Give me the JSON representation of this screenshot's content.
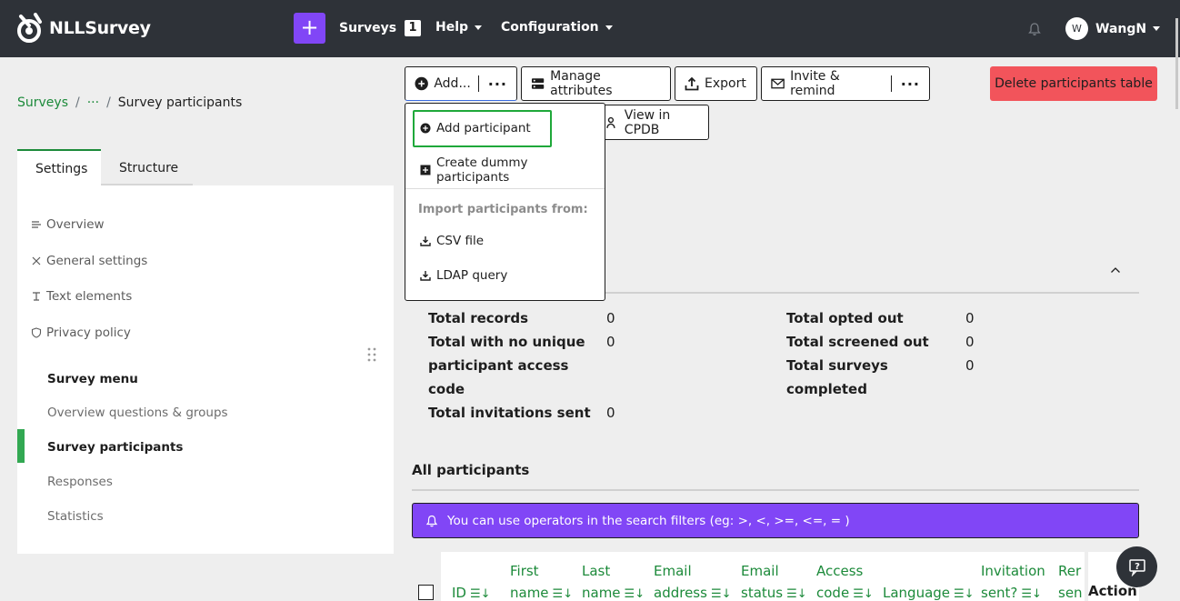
{
  "app": {
    "name": "NLLSurvey"
  },
  "nav": {
    "surveys_label": "Surveys",
    "surveys_count": "1",
    "help_label": "Help",
    "config_label": "Configuration",
    "user_initial": "W",
    "user_name": "WangN"
  },
  "breadcrumb": {
    "root": "Surveys",
    "ellipsis": "···",
    "sep": "/",
    "current": "Survey participants"
  },
  "sidebar": {
    "tabs": [
      "Settings",
      "Structure"
    ],
    "settings_items": [
      "Overview",
      "General settings",
      "Text elements",
      "Privacy policy"
    ],
    "menu_heading": "Survey menu",
    "menu_items": [
      "Overview questions & groups",
      "Survey participants",
      "Responses",
      "Statistics"
    ]
  },
  "toolbar": {
    "add_label": "Add...",
    "manage_label": "Manage attributes",
    "export_label": "Export",
    "invite_label": "Invite & remind",
    "delete_label": "Delete participants table",
    "cpdb_label": "View in CPDB"
  },
  "dropdown": {
    "add_participant": "Add participant",
    "create_dummy": "Create dummy participants",
    "import_header": "Import participants from:",
    "csv": "CSV file",
    "ldap": "LDAP query"
  },
  "summary": {
    "total_records_label": "Total records",
    "total_records": "0",
    "no_unique_label_1": "Total with no unique",
    "no_unique_label_2": "participant access",
    "no_unique_label_3": "code",
    "no_unique": "0",
    "invitations_sent_label": "Total invitations sent",
    "invitations_sent": "0",
    "opted_out_label": "Total opted out",
    "opted_out": "0",
    "screened_out_label": "Total screened out",
    "screened_out": "0",
    "completed_label_1": "Total surveys",
    "completed_label_2": "completed",
    "completed": "0"
  },
  "participants": {
    "title": "All participants",
    "info": "You can use operators in the search filters (eg: >, <, >=, <=, = )",
    "columns": [
      [
        "",
        "ID"
      ],
      [
        "First",
        "name"
      ],
      [
        "Last",
        "name"
      ],
      [
        "Email",
        "address"
      ],
      [
        "Email",
        "status"
      ],
      [
        "Access",
        "code"
      ],
      [
        "",
        "Language"
      ],
      [
        "Invitation",
        "sent?"
      ],
      [
        "Rer",
        "sen"
      ]
    ],
    "action_label": "Action",
    "sort_glyph": "☰↓"
  },
  "colors": {
    "brand_purple": "#8146f6",
    "green": "#1c8a3a",
    "danger": "#f2545b",
    "navbar": "#2e3238"
  }
}
